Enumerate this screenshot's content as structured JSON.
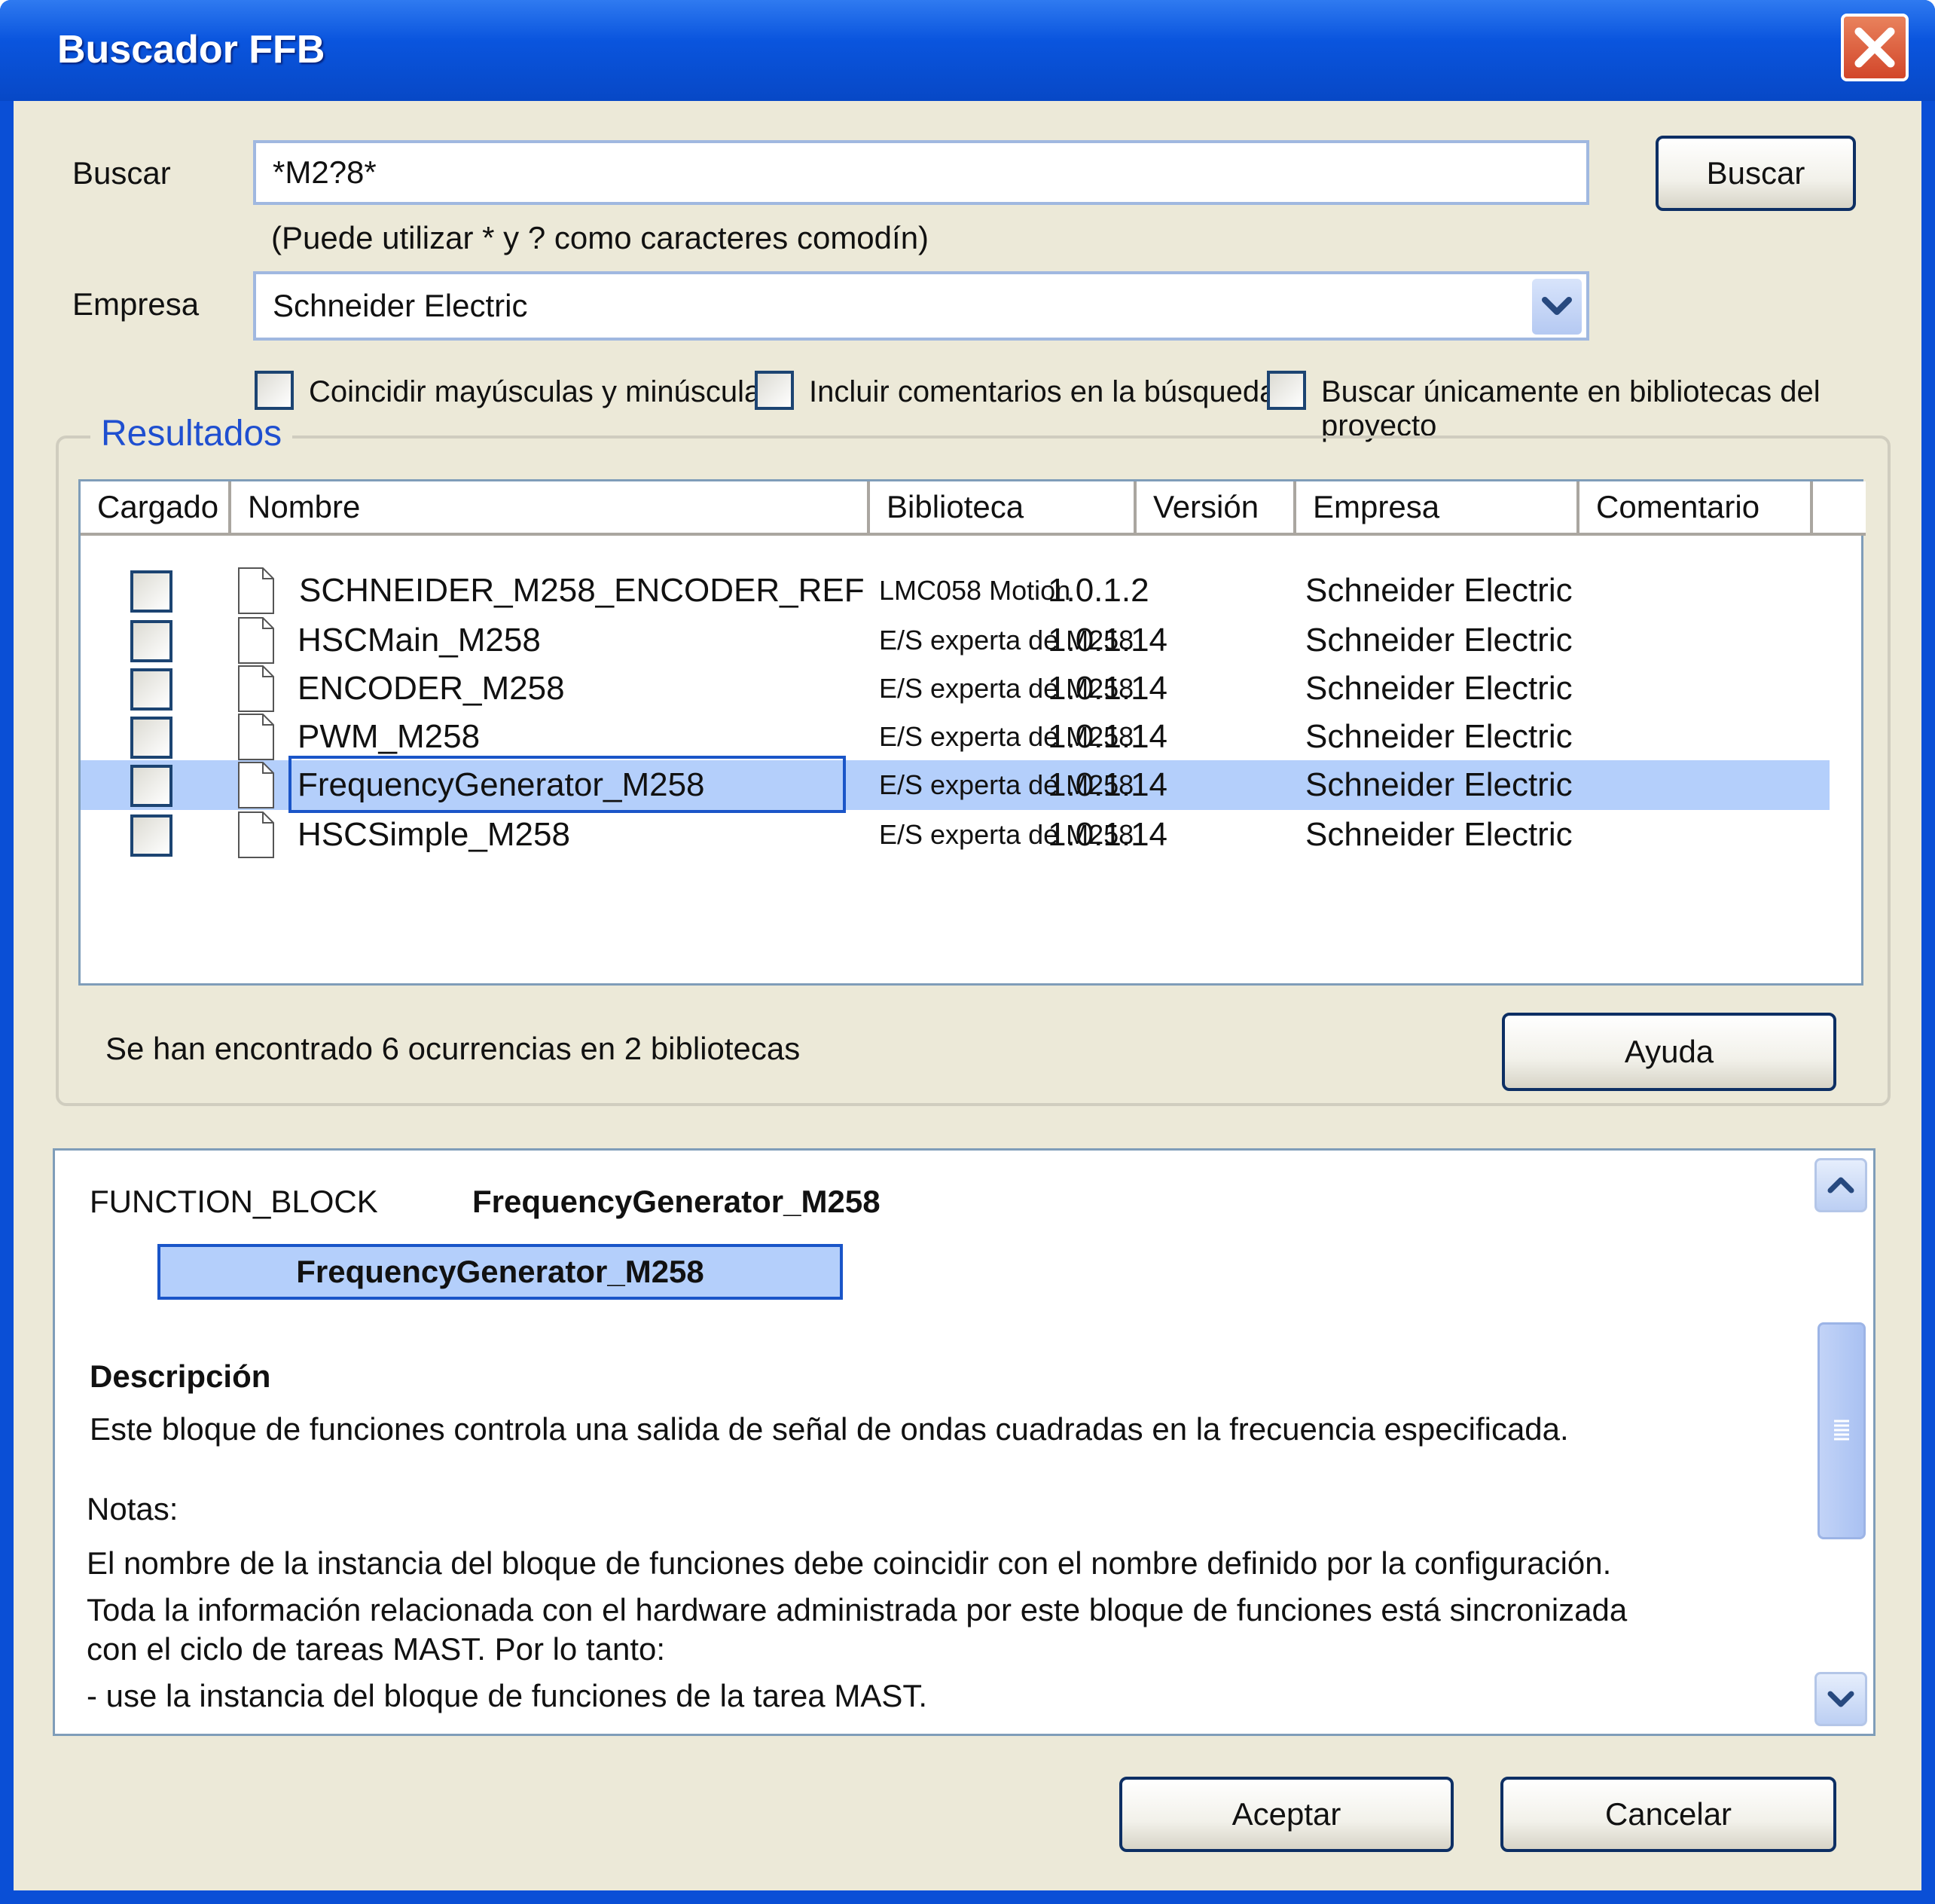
{
  "window": {
    "title": "Buscador FFB"
  },
  "search": {
    "label": "Buscar",
    "value": "*M2?8*",
    "hint": "(Puede utilizar * y ? como caracteres comodín)",
    "button": "Buscar"
  },
  "company": {
    "label": "Empresa",
    "selected": "Schneider Electric"
  },
  "options": [
    {
      "label": "Coincidir mayúsculas y minúsculas",
      "checked": false
    },
    {
      "label": "Incluir comentarios en la búsqueda",
      "checked": false
    },
    {
      "label": "Buscar únicamente en bibliotecas del proyecto",
      "checked": false
    }
  ],
  "results": {
    "title": "Resultados",
    "columns": [
      "Cargado",
      "Nombre",
      "Biblioteca",
      "Versión",
      "Empresa",
      "Comentario"
    ],
    "rows": [
      {
        "loaded": false,
        "name": "SCHNEIDER_M258_ENCODER_REF",
        "library": "LMC058 Motion",
        "version": "1.0.1.2",
        "company": "Schneider Electric",
        "comment": "",
        "selected": false
      },
      {
        "loaded": false,
        "name": "HSCMain_M258",
        "library": "E/S experta de M258",
        "version": "1.0.1.14",
        "company": "Schneider Electric",
        "comment": "",
        "selected": false
      },
      {
        "loaded": false,
        "name": "ENCODER_M258",
        "library": "E/S experta de M258",
        "version": "1.0.1.14",
        "company": "Schneider Electric",
        "comment": "",
        "selected": false
      },
      {
        "loaded": false,
        "name": "PWM_M258",
        "library": "E/S experta de M258",
        "version": "1.0.1.14",
        "company": "Schneider Electric",
        "comment": "",
        "selected": false
      },
      {
        "loaded": false,
        "name": "FrequencyGenerator_M258",
        "library": "E/S experta de M258",
        "version": "1.0.1.14",
        "company": "Schneider Electric",
        "comment": "",
        "selected": true
      },
      {
        "loaded": false,
        "name": "HSCSimple_M258",
        "library": "E/S experta de M258",
        "version": "1.0.1.14",
        "company": "Schneider Electric",
        "comment": "",
        "selected": false
      }
    ],
    "status": "Se han encontrado 6 ocurrencias en 2 bibliotecas",
    "help_button": "Ayuda"
  },
  "detail": {
    "kind": "FUNCTION_BLOCK",
    "name": "FrequencyGenerator_M258",
    "box_label": "FrequencyGenerator_M258",
    "description_heading": "Descripción",
    "description": "Este bloque de funciones controla una salida de señal de ondas cuadradas en la frecuencia especificada.",
    "notes_heading": "Notas:",
    "note_1": "El nombre de la instancia del bloque de funciones debe coincidir con el nombre definido por la configuración.",
    "note_2a": "Toda la información relacionada con el hardware administrada por este bloque de funciones está sincronizada",
    "note_2b": "con el ciclo de tareas MAST. Por lo tanto:",
    "note_3": "- use la instancia del bloque de funciones de la tarea MAST."
  },
  "footer": {
    "ok_button": "Aceptar",
    "cancel_button": "Cancelar"
  },
  "colors": {
    "titlebar": "#0a55de",
    "selection": "#b4cffb",
    "group_title": "#1f4fd0",
    "dialog_bg": "#ece9d8"
  },
  "icons": [
    "close-icon",
    "chevron-down-icon",
    "document-icon",
    "scroll-up-icon",
    "scroll-down-icon",
    "scroll-grip-icon"
  ]
}
